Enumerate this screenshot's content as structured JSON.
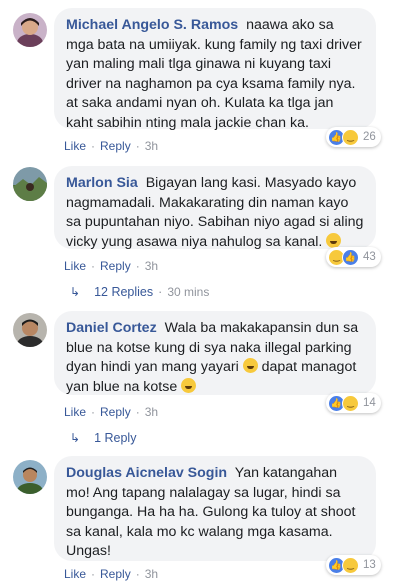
{
  "comments": [
    {
      "name": "Michael Angelo S. Ramos",
      "text": "naawa ako sa mga bata na umiiyak. kung family ng taxi driver yan maling mali tlga ginawa ni kuyang taxi driver na naghamon pa cya ksama family nya. at saka andami nyan oh. Kulata ka tlga jan kaht sabihin nting mala jackie chan ka.",
      "like": "Like",
      "reply": "Reply",
      "time": "3h",
      "reaction_count": "26",
      "reaction_icons": [
        "like-icon",
        "haha-icon"
      ]
    },
    {
      "name": "Marlon Sia",
      "text": "Bigayan lang kasi. Masyado kayo nagmamadali. Makakarating din naman kayo sa pupuntahan niyo. Sabihan niyo agad si aling vicky yung asawa niya nahulog sa kanal.",
      "like": "Like",
      "reply": "Reply",
      "time": "3h",
      "reaction_count": "43",
      "reaction_icons": [
        "haha-icon",
        "like-icon"
      ],
      "replies_label": "12 Replies",
      "replies_time": "30 mins"
    },
    {
      "name": "Daniel Cortez",
      "text_before": "Wala ba makakapansin dun sa blue na kotse kung di sya naka illegal parking dyan hindi yan mang yayari",
      "text_middle": "dapat managot yan blue na kotse",
      "like": "Like",
      "reply": "Reply",
      "time": "3h",
      "reaction_count": "14",
      "reaction_icons": [
        "like-icon",
        "haha-icon"
      ],
      "replies_label": "1 Reply"
    },
    {
      "name": "Douglas Aicnelav Sogin",
      "text": "Yan katangahan mo! Ang tapang nalalagay sa lugar, hindi sa bunganga. Ha ha ha. Gulong ka tuloy at shoot sa kanal, kala mo kc walang mga kasama. Ungas!",
      "like": "Like",
      "reply": "Reply",
      "time": "3h",
      "reaction_count": "13",
      "reaction_icons": [
        "like-icon",
        "haha-icon"
      ]
    }
  ],
  "colors": {
    "name_link": "#385898",
    "bubble_bg": "#f2f3f5",
    "meta_gray": "#90949c",
    "like_blue": "#4a7fe8",
    "haha_yellow": "#f7c93c"
  }
}
